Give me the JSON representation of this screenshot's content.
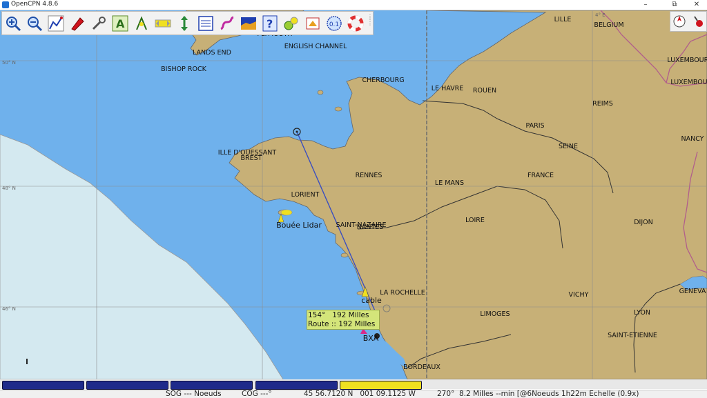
{
  "window": {
    "title": "OpenCPN 4.8.6",
    "controls": {
      "minimize": "–",
      "maximize": "⧉",
      "close": "✕"
    }
  },
  "toolbar": {
    "buttons": [
      {
        "icon": "zoom-in-icon"
      },
      {
        "icon": "zoom-out-icon"
      },
      {
        "icon": "route-icon"
      },
      {
        "icon": "ship-icon"
      },
      {
        "icon": "settings-wrench-icon"
      },
      {
        "icon": "text-tool-icon"
      },
      {
        "icon": "show-currents-icon"
      },
      {
        "icon": "tides-icon"
      },
      {
        "icon": "measure-icon"
      },
      {
        "icon": "route-manager-icon"
      },
      {
        "icon": "track-icon"
      },
      {
        "icon": "chart-icon"
      },
      {
        "icon": "help-icon"
      },
      {
        "icon": "ais-icon"
      },
      {
        "icon": "print-icon"
      },
      {
        "icon": "counter-icon",
        "label": "0.1"
      },
      {
        "icon": "lifebuoy-icon"
      }
    ]
  },
  "colors": {
    "sea": "#6fb1ec",
    "deep_sea": "#d4e9f0",
    "land": "#c7b077",
    "accent_yellow": "#f0e020",
    "info_bg": "#d4e57a",
    "pianobar_key": "#1e2a8a"
  },
  "map": {
    "latitude_labels": [
      "50° N",
      "48° N",
      "46° N"
    ],
    "longitude_labels": [
      "4° E"
    ],
    "labels": [
      "LILLE",
      "BELGIUM",
      "PLYMOUTH",
      "LANDS END",
      "ENGLISH CHANNEL",
      "BISHOP ROCK",
      "LUXEMBOURG",
      "LUXEMBOURG",
      "CHERBOURG",
      "LE HAVRE",
      "ROUEN",
      "REIMS",
      "PARIS",
      "SEINE",
      "NANCY",
      "ILLE D'OUESSANT",
      "BREST",
      "RENNES",
      "LE MANS",
      "FRANCE",
      "LORIENT",
      "Bouée Lidar",
      "SAINT-NAZAIRE",
      "NANTES",
      "LOIRE",
      "DIJON",
      "LA ROCHELLE",
      "cable",
      "VICHY",
      "GENEVA",
      "LIMOGES",
      "LYON",
      "BXA",
      "SAINT-ETIENNE",
      "BORDEAUX"
    ]
  },
  "route_info": {
    "line1": "154°   192 Milles",
    "line2": "Route :: 192 Milles"
  },
  "pianobar": {
    "keys": [
      {
        "active": false
      },
      {
        "active": false
      },
      {
        "active": false
      },
      {
        "active": false
      },
      {
        "active": true
      }
    ]
  },
  "status": {
    "sog": "SOG --- Noeuds",
    "cog": "COG ---°",
    "position": "45 56.7120 N   001 09.1125 W",
    "cursor": "270°  8.2 Milles --min [@6Noeuds 1h22m Echelle (0.9x)"
  }
}
